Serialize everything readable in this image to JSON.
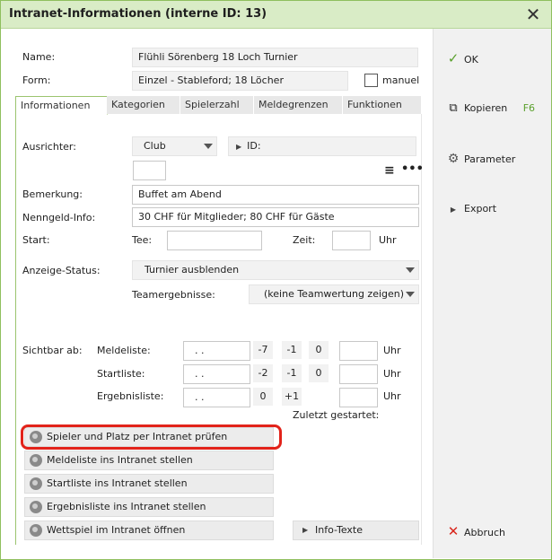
{
  "window": {
    "title": "Intranet-Informationen (interne ID: 13)"
  },
  "form": {
    "name_label": "Name:",
    "name_value": "Flühli Sörenberg 18 Loch Turnier",
    "form_label": "Form:",
    "form_value": "Einzel - Stableford; 18 Löcher",
    "manual_label": "manuel",
    "manual_checked": false
  },
  "tabs": [
    {
      "label": "Informationen",
      "active": true
    },
    {
      "label": "Kategorien",
      "active": false
    },
    {
      "label": "Spielerzahl",
      "active": false
    },
    {
      "label": "Meldegrenzen",
      "active": false
    },
    {
      "label": "Funktionen",
      "active": false
    }
  ],
  "info": {
    "organizer_label": "Ausrichter:",
    "organizer_value": "Club",
    "id_label": "ID:",
    "remark_label": "Bemerkung:",
    "remark_value": "Buffet am Abend",
    "fee_label": "Nenngeld-Info:",
    "fee_value": "30 CHF für Mitglieder; 80 CHF für Gäste",
    "start_label": "Start:",
    "tee_label": "Tee:",
    "time_label": "Zeit:",
    "hour_label": "Uhr",
    "display_status_label": "Anzeige-Status:",
    "display_status_value": "Turnier ausblenden",
    "team_results_label": "Teamergebnisse:",
    "team_results_value": "(keine Teamwertung zeigen)"
  },
  "visibility": {
    "visible_from_label": "Sichtbar ab:",
    "rows": [
      {
        "label": "Meldeliste:",
        "date": " .  .",
        "a": "-7",
        "b": "-1",
        "c": "0",
        "uhr": "Uhr"
      },
      {
        "label": "Startliste:",
        "date": " .  .",
        "a": "-2",
        "b": "-1",
        "c": "0",
        "uhr": "Uhr"
      },
      {
        "label": "Ergebnisliste:",
        "date": " .  .",
        "a": "0",
        "b": "+1",
        "c": "",
        "uhr": "Uhr"
      }
    ],
    "last_started_label": "Zuletzt gestartet:"
  },
  "actions": [
    "Spieler und Platz per Intranet prüfen",
    "Meldeliste ins Intranet stellen",
    "Startliste ins Intranet stellen",
    "Ergebnisliste ins Intranet stellen",
    "Wettspiel im Intranet öffnen"
  ],
  "info_texts_label": "Info-Texte",
  "side": {
    "ok": "OK",
    "copy": "Kopieren",
    "copy_shortcut": "F6",
    "parameter": "Parameter",
    "export": "Export",
    "cancel": "Abbruch"
  },
  "colors": {
    "accent_green": "#5aa02c",
    "highlight_red": "#e2231a",
    "cancel_red": "#d9261c"
  }
}
